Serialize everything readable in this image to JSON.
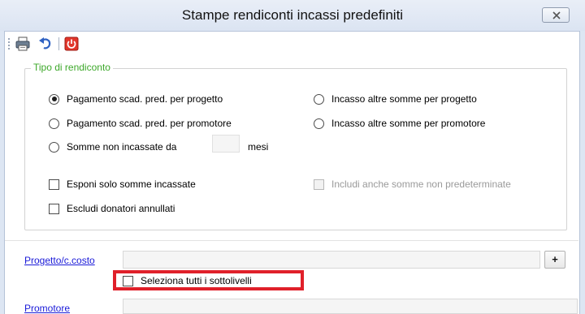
{
  "window": {
    "title": "Stampe rendiconti incassi predefiniti"
  },
  "group": {
    "legend": "Tipo di rendiconto",
    "radios": [
      {
        "label": "Pagamento scad. pred. per progetto",
        "checked": true
      },
      {
        "label": "Pagamento scad. pred. per promotore",
        "checked": false
      },
      {
        "label": "Somme non incassate da",
        "checked": false
      },
      {
        "label": "Incasso altre somme per progetto",
        "checked": false
      },
      {
        "label": "Incasso altre somme per promotore",
        "checked": false
      }
    ],
    "mesi_label": "mesi",
    "checkboxes": [
      {
        "label": "Esponi solo somme incassate",
        "checked": false
      },
      {
        "label": "Escludi donatori annullati",
        "checked": false
      },
      {
        "label": "Includi anche somme non predeterminate",
        "checked": false,
        "disabled": true
      }
    ]
  },
  "fields": {
    "progetto_label": "Progetto/c.costo",
    "plus_label": "+",
    "seleziona_label": "Seleziona tutti i sottolivelli",
    "promotore_label": "Promotore"
  },
  "colors": {
    "legend": "#3da82a",
    "link": "#1a1ad8",
    "highlight": "#e0202a"
  }
}
